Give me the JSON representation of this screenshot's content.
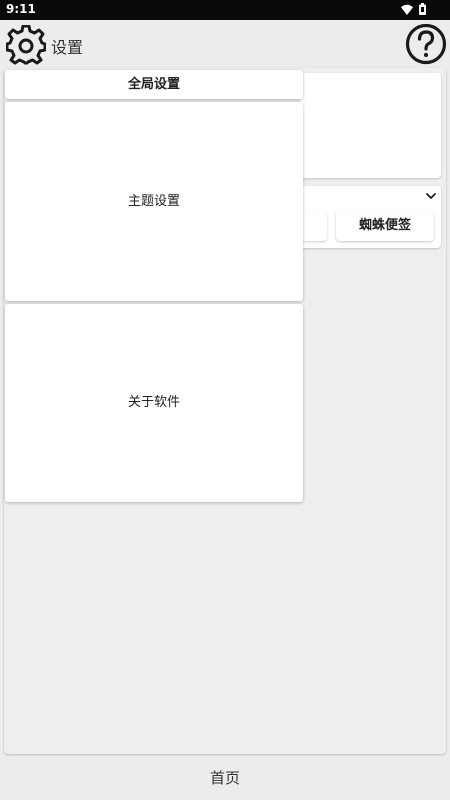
{
  "status_bar": {
    "time": "9:11",
    "icons": [
      "wifi-icon",
      "battery-icon"
    ]
  },
  "header": {
    "title": "设置",
    "left_icon": "gear-icon",
    "right_icon": "help-icon"
  },
  "dropdown_menu": {
    "items": [
      {
        "label": "全局设置"
      },
      {
        "label": "主题设置"
      },
      {
        "label": "关于软件"
      }
    ]
  },
  "background": {
    "chip_label": "蜘蛛便签",
    "expand_icon": "chevron-down-icon"
  },
  "bottom_nav": {
    "home_label": "首页"
  },
  "colors": {
    "status_bar": "#0a0a0a",
    "background": "#ececec",
    "surface": "#ffffff",
    "text": "#222222"
  }
}
